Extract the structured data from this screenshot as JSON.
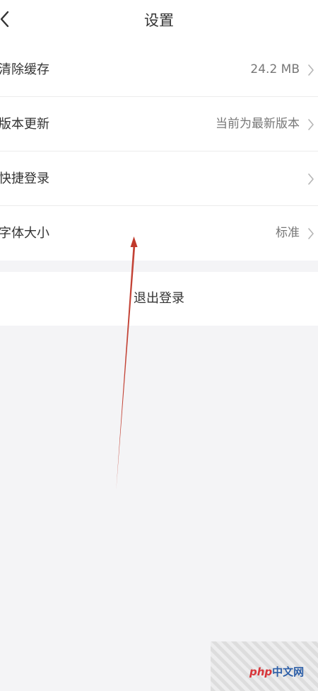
{
  "header": {
    "title": "设置",
    "back_icon": "chevron-left-icon"
  },
  "settings": {
    "items": [
      {
        "label": "清除缓存",
        "value": "24.2 MB"
      },
      {
        "label": "版本更新",
        "value": "当前为最新版本"
      },
      {
        "label": "快捷登录",
        "value": ""
      },
      {
        "label": "字体大小",
        "value": "标准"
      }
    ]
  },
  "logout": {
    "label": "退出登录"
  },
  "annotation": {
    "color": "#c0392b",
    "icon": "red-arrow-annotation"
  },
  "watermark": {
    "brand": "php",
    "site": "中文网"
  }
}
